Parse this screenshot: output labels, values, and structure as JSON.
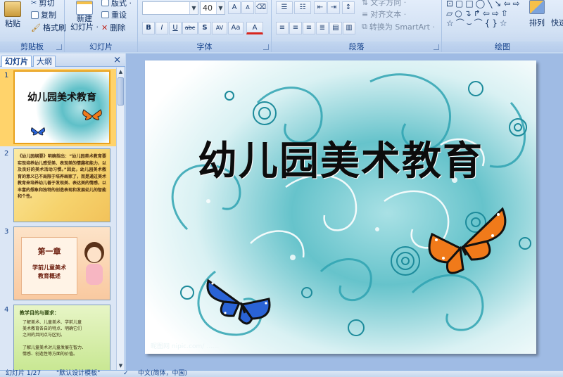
{
  "ribbon": {
    "clipboard": {
      "label": "剪贴板",
      "paste": "粘贴",
      "cut": "剪切",
      "copy": "复制",
      "format_painter": "格式刷"
    },
    "slides": {
      "label": "幻灯片",
      "new_slide_line1": "新建",
      "new_slide_line2": "幻灯片 ·",
      "layout": "版式 ·",
      "reset": "重设",
      "delete": "删除"
    },
    "font": {
      "label": "字体",
      "font_name": "",
      "font_size": "40",
      "bold": "B",
      "italic": "I",
      "underline": "U",
      "strike": "abc",
      "shadow": "S",
      "spacing": "AV",
      "case": "Aa",
      "color": "A"
    },
    "paragraph": {
      "label": "段落",
      "text_direction": "文字方向 ·",
      "align_text": "对齐文本 ·",
      "smartart": "转换为 SmartArt ·"
    },
    "drawing": {
      "label": "绘图",
      "arrange": "排列",
      "quick_styles": "快速"
    }
  },
  "pane": {
    "tab_slides": "幻灯片",
    "tab_outline": "大纲",
    "close": "×",
    "slides": [
      {
        "num": "1",
        "title": "幼儿园美术教育"
      },
      {
        "num": "2",
        "text": "《幼儿园纲要》明确指出：“幼儿园美术教育要实现培养幼儿感受美、表现美的情趣和能力，以及良好的美术活动习惯。”因此，幼儿园美术教育的意义已不局限于培养画家了，而是通过美术教育来培养幼儿善于发现美、表达美的情感，以丰富的想象和独特的创造表现和发展幼儿的智能和个性。"
      },
      {
        "num": "3",
        "chapter": "第一章",
        "subtitle_1": "学前儿童美术",
        "subtitle_2": "教育概述"
      },
      {
        "num": "4",
        "heading": "教学目的与要求：",
        "item_1": "了解美术、儿童美术、学前儿童美术教育各自的特点、明确它们之间的共同点与区别。",
        "item_2": "了解儿童美术对儿童发展在智力、情感、创造性等方面的价值。"
      }
    ]
  },
  "slide": {
    "title": "幼儿园美术教育",
    "watermark": "昵图网 nipic.com/ ……"
  },
  "status": {
    "slide_count": "幻灯片 1/27",
    "theme": "\"默认设计模板\"",
    "language": "中文(简体，中国)"
  },
  "colors": {
    "accent_teal": "#2fb0bd",
    "butterfly_orange": "#f07a1a",
    "butterfly_blue": "#2a63d6"
  }
}
